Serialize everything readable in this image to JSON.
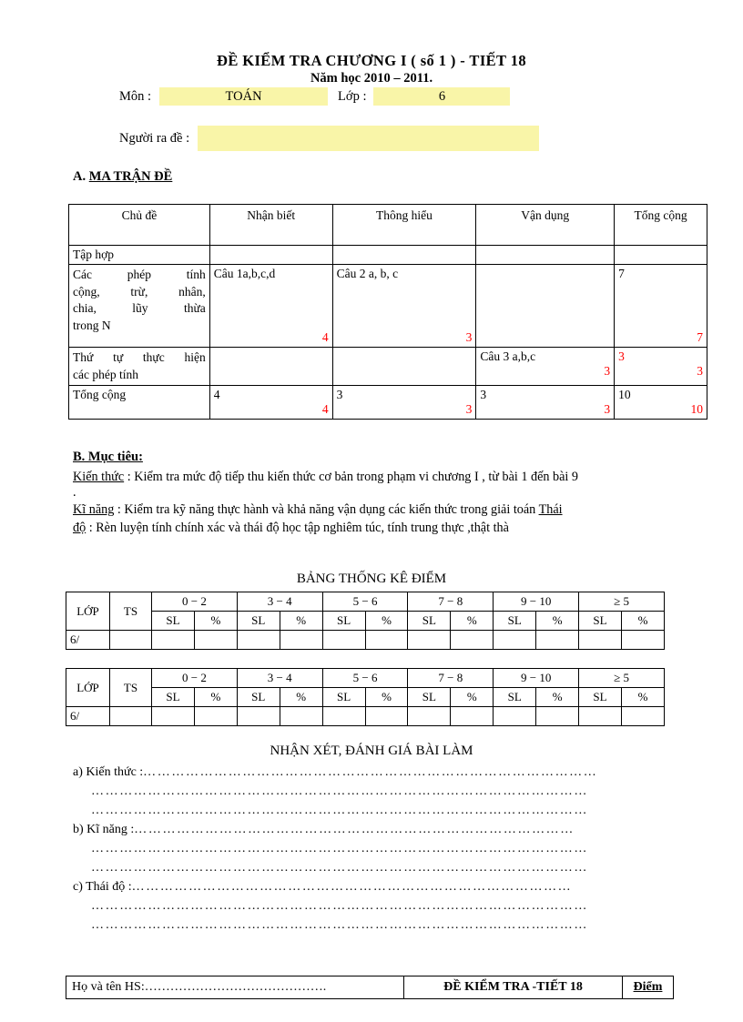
{
  "header": {
    "title": "ĐỀ KIỂM TRA  CHƯƠNG I ( số 1 ) - TIẾT  18",
    "subtitle": "Năm học 2010 – 2011.",
    "subject_label": "Môn :",
    "subject_value": "TOÁN",
    "class_label": "Lớp :",
    "class_value": "6",
    "author_label": "Người ra đề :",
    "author_value": "",
    "highlight_color": "#F9F5A8"
  },
  "section_a": {
    "prefix": "A. ",
    "heading": "MA TRẬN  ĐỀ"
  },
  "matrix": {
    "columns": [
      "Chủ đề",
      "Nhận biết",
      "Thông hiểu",
      "Vận dụng",
      "Tổng cộng"
    ],
    "rows": [
      {
        "topic": "Tập hợp",
        "topic_lines": [
          "Tập hợp"
        ],
        "nhan_biet": "",
        "nhan_biet_score": "",
        "thong_hieu": "",
        "thong_hieu_score": "",
        "van_dung": "",
        "van_dung_score": "",
        "tong_cong": "",
        "tong_cong_score": ""
      },
      {
        "topic": "Các phép tính cộng, trừ, nhân, chia, lũy thừa trong N",
        "topic_lines": [
          "Các    phép    tính",
          "cộng,   trừ,   nhân,",
          "chia,   lũy   thừa",
          "trong N"
        ],
        "nhan_biet": "Câu 1a,b,c,d",
        "nhan_biet_score": "4",
        "thong_hieu": "Câu 2 a, b, c",
        "thong_hieu_score": "3",
        "van_dung": "",
        "van_dung_score": "",
        "tong_cong": "7",
        "tong_cong_score": "7"
      },
      {
        "topic": "Thứ tự thực hiện các phép tính",
        "topic_lines": [
          "Thứ  tự  thực  hiện",
          "các phép tính"
        ],
        "nhan_biet": "",
        "nhan_biet_score": "",
        "thong_hieu": "",
        "thong_hieu_score": "",
        "van_dung": "Câu 3 a,b,c",
        "van_dung_score": "3",
        "tong_cong": "3",
        "tong_cong_score": "3",
        "tong_cong_red": true
      },
      {
        "topic": "Tổng cộng",
        "topic_lines": [
          "Tổng cộng"
        ],
        "nhan_biet": "4",
        "nhan_biet_score": "4",
        "thong_hieu": "3",
        "thong_hieu_score": "3",
        "van_dung": "3",
        "van_dung_score": "3",
        "tong_cong": "10",
        "tong_cong_score": "10"
      }
    ],
    "score_color": "#FF0000"
  },
  "section_b": {
    "heading": "B. Mục tiêu:",
    "kien_thuc_label": "Kiến thức",
    "kien_thuc_text": " : Kiểm tra mức độ tiếp thu kiến thức cơ bản trong phạm vi chương I , từ bài 1 đến bài 9",
    "dot_line": ".",
    "ki_nang_label": "Kĩ năng",
    "ki_nang_text": " : Kiểm tra kỹ năng thực hành và khả năng vận dụng các kiến thức trong giải toán  ",
    "thai_label": "Thái",
    "do_label": "độ",
    "thai_do_text": " : Rèn luyện tính chính xác và thái độ học tập nghiêm túc, tính trung thực ,thật thà"
  },
  "stats": {
    "title": "BẢNG THỐNG KÊ ĐIỂM",
    "header_lop": "LỚP",
    "header_ts": "TS",
    "ranges": [
      "0 − 2",
      "3 − 4",
      "5 − 6",
      "7 − 8",
      "9 − 10",
      "≥ 5"
    ],
    "sub_sl": "SL",
    "sub_pct": "%",
    "class_row": "6/",
    "tables": [
      {
        "class_row": "6/",
        "ts": ""
      },
      {
        "class_row": "6/",
        "ts": ""
      }
    ]
  },
  "comments": {
    "title": "NHẬN XÉT, ĐÁNH GIÁ BÀI LÀM",
    "items": [
      {
        "label": "a) Kiến thức :",
        "dots": "……………………………………………………………………………………"
      },
      {
        "label": "",
        "dots": "……………………………………………………………………………………………"
      },
      {
        "label": "",
        "dots": "……………………………………………………………………………………………"
      },
      {
        "label": "b) Kĩ năng :",
        "dots": "…………………………………………………………………………………"
      },
      {
        "label": "",
        "dots": "……………………………………………………………………………………………"
      },
      {
        "label": "",
        "dots": "……………………………………………………………………………………………"
      },
      {
        "label": "c) Thái độ :",
        "dots": "…………………………………………………………………………………"
      },
      {
        "label": "",
        "dots": "……………………………………………………………………………………………"
      },
      {
        "label": "",
        "dots": "……………………………………………………………………………………………"
      }
    ]
  },
  "footer": {
    "name_label": "Họ và tên HS:",
    "name_dots": "…………………………………….",
    "exam_title": "ĐỀ KIỂM TRA -TIẾT  18",
    "score_label": "Điểm"
  }
}
